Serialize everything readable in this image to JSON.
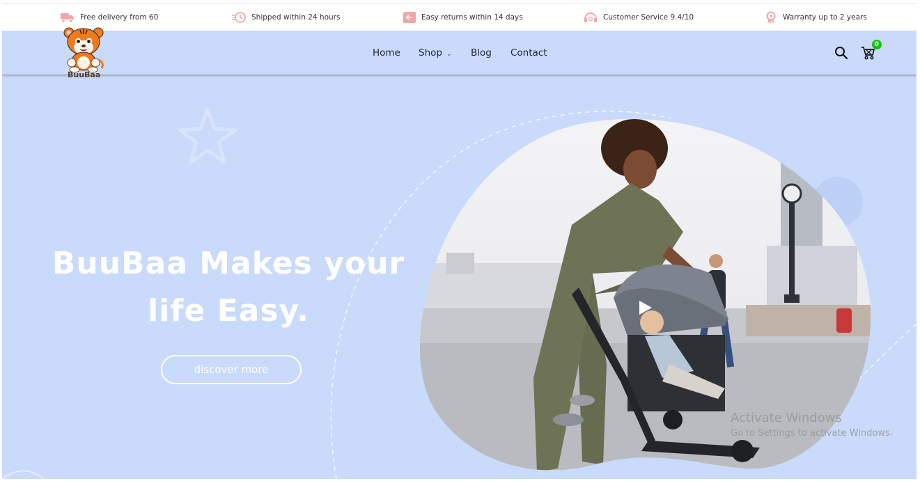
{
  "topbar": {
    "items": [
      {
        "icon": "delivery-truck-icon",
        "text": "Free delivery from 60"
      },
      {
        "icon": "fast-clock-icon",
        "text": "Shipped within 24 hours"
      },
      {
        "icon": "return-box-icon",
        "text": "Easy returns within 14 days"
      },
      {
        "icon": "headset-icon",
        "text": "Customer Service 9.4/10"
      },
      {
        "icon": "award-ribbon-icon",
        "text": "Warranty up to 2 years"
      }
    ]
  },
  "header": {
    "logo_text": "BuuBaa",
    "nav": [
      {
        "label": "Home"
      },
      {
        "label": "Shop",
        "has_dropdown": true
      },
      {
        "label": "Blog"
      },
      {
        "label": "Contact"
      }
    ],
    "cart_count": "0"
  },
  "hero": {
    "title_line1": "BuuBaa Makes your",
    "title_line2": "life Easy.",
    "cta_label": "discover more"
  },
  "watermark": {
    "line1": "Activate Windows",
    "line2": "Go to Settings to activate Windows."
  },
  "colors": {
    "background": "#c9dafa",
    "accent_icon": "#f0a6a6",
    "badge": "#18c30f"
  }
}
